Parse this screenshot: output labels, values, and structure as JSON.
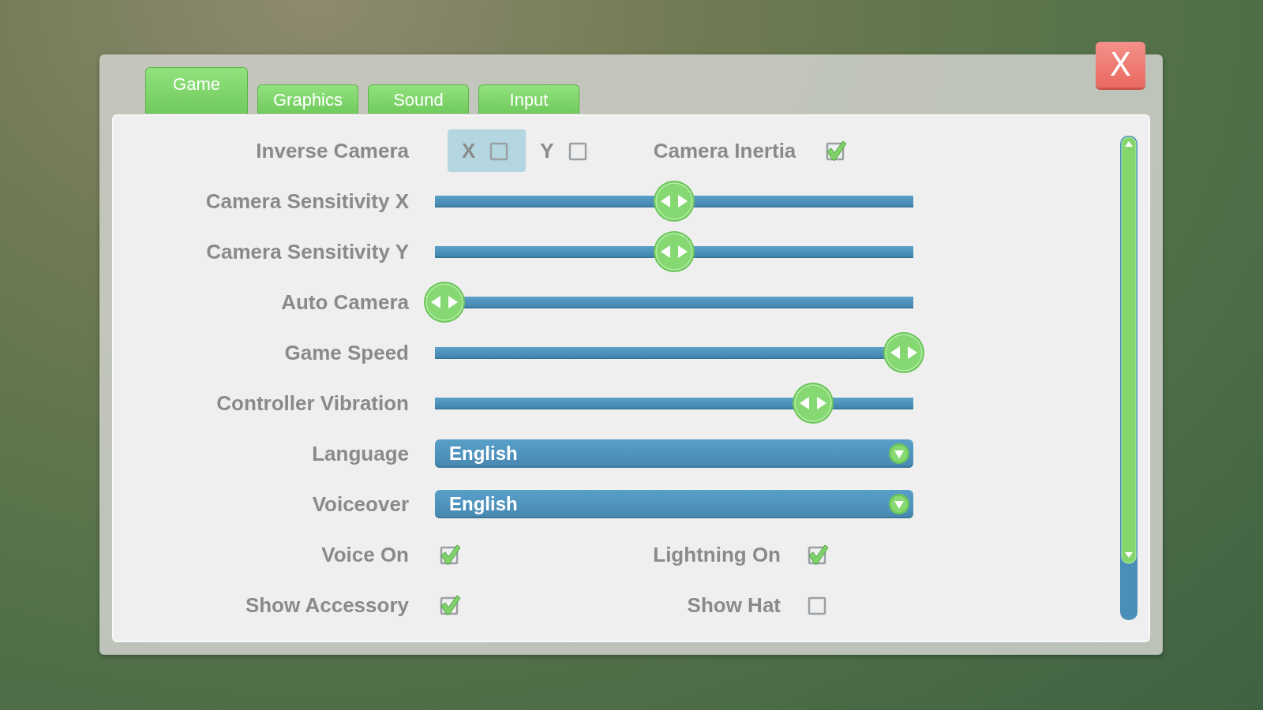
{
  "close_button": {
    "label": "X"
  },
  "tabs": [
    {
      "label": "Game",
      "selected": true
    },
    {
      "label": "Graphics",
      "selected": false
    },
    {
      "label": "Sound",
      "selected": false
    },
    {
      "label": "Input",
      "selected": false
    }
  ],
  "settings": [
    {
      "kind": "axis-checks",
      "label": "Inverse Camera",
      "options": [
        {
          "label": "X",
          "checked": false,
          "highlighted": true
        },
        {
          "label": "Y",
          "checked": false,
          "highlighted": false
        }
      ],
      "extra": {
        "label": "Camera Inertia",
        "checked": true
      }
    },
    {
      "kind": "slider",
      "label": "Camera Sensitivity X",
      "level": 0.5
    },
    {
      "kind": "slider",
      "label": "Camera Sensitivity Y",
      "level": 0.5
    },
    {
      "kind": "slider",
      "label": "Auto Camera",
      "level": 0.02
    },
    {
      "kind": "slider",
      "label": "Game Speed",
      "level": 0.98
    },
    {
      "kind": "slider",
      "label": "Controller Vibration",
      "level": 0.79
    },
    {
      "kind": "dropdown",
      "label": "Language",
      "value": "English"
    },
    {
      "kind": "dropdown",
      "label": "Voiceover",
      "value": "English"
    },
    {
      "kind": "check-pair",
      "label": "Voice On",
      "checked": true,
      "right": {
        "label": "Lightning On",
        "checked": true
      }
    },
    {
      "kind": "check-pair",
      "label": "Show Accessory",
      "checked": true,
      "right": {
        "label": "Show Hat",
        "checked": false
      }
    }
  ]
}
